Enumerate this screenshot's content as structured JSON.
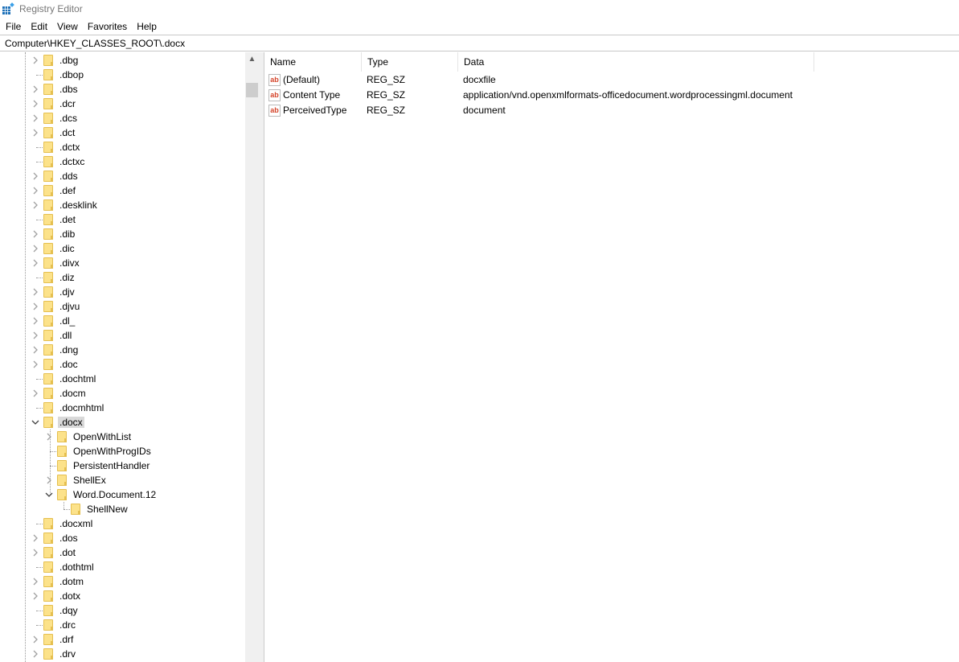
{
  "window": {
    "title": "Registry Editor"
  },
  "menu": [
    "File",
    "Edit",
    "View",
    "Favorites",
    "Help"
  ],
  "address": "Computer\\HKEY_CLASSES_ROOT\\.docx",
  "tree": [
    {
      "label": ".dbg",
      "level": 1,
      "state": "collapsed"
    },
    {
      "label": ".dbop",
      "level": 1,
      "state": "leaf"
    },
    {
      "label": ".dbs",
      "level": 1,
      "state": "collapsed"
    },
    {
      "label": ".dcr",
      "level": 1,
      "state": "collapsed"
    },
    {
      "label": ".dcs",
      "level": 1,
      "state": "collapsed"
    },
    {
      "label": ".dct",
      "level": 1,
      "state": "collapsed"
    },
    {
      "label": ".dctx",
      "level": 1,
      "state": "leaf"
    },
    {
      "label": ".dctxc",
      "level": 1,
      "state": "leaf"
    },
    {
      "label": ".dds",
      "level": 1,
      "state": "collapsed"
    },
    {
      "label": ".def",
      "level": 1,
      "state": "collapsed"
    },
    {
      "label": ".desklink",
      "level": 1,
      "state": "collapsed"
    },
    {
      "label": ".det",
      "level": 1,
      "state": "leaf"
    },
    {
      "label": ".dib",
      "level": 1,
      "state": "collapsed"
    },
    {
      "label": ".dic",
      "level": 1,
      "state": "collapsed"
    },
    {
      "label": ".divx",
      "level": 1,
      "state": "collapsed"
    },
    {
      "label": ".diz",
      "level": 1,
      "state": "leaf"
    },
    {
      "label": ".djv",
      "level": 1,
      "state": "collapsed"
    },
    {
      "label": ".djvu",
      "level": 1,
      "state": "collapsed"
    },
    {
      "label": ".dl_",
      "level": 1,
      "state": "collapsed"
    },
    {
      "label": ".dll",
      "level": 1,
      "state": "collapsed"
    },
    {
      "label": ".dng",
      "level": 1,
      "state": "collapsed"
    },
    {
      "label": ".doc",
      "level": 1,
      "state": "collapsed"
    },
    {
      "label": ".dochtml",
      "level": 1,
      "state": "leaf"
    },
    {
      "label": ".docm",
      "level": 1,
      "state": "collapsed"
    },
    {
      "label": ".docmhtml",
      "level": 1,
      "state": "leaf"
    },
    {
      "label": ".docx",
      "level": 1,
      "state": "expanded",
      "selected": true
    },
    {
      "label": "OpenWithList",
      "level": 2,
      "state": "collapsed"
    },
    {
      "label": "OpenWithProgIDs",
      "level": 2,
      "state": "leaf"
    },
    {
      "label": "PersistentHandler",
      "level": 2,
      "state": "leaf"
    },
    {
      "label": "ShellEx",
      "level": 2,
      "state": "collapsed"
    },
    {
      "label": "Word.Document.12",
      "level": 2,
      "state": "expanded"
    },
    {
      "label": "ShellNew",
      "level": 3,
      "state": "leaf"
    },
    {
      "label": ".docxml",
      "level": 1,
      "state": "leaf"
    },
    {
      "label": ".dos",
      "level": 1,
      "state": "collapsed"
    },
    {
      "label": ".dot",
      "level": 1,
      "state": "collapsed"
    },
    {
      "label": ".dothtml",
      "level": 1,
      "state": "leaf"
    },
    {
      "label": ".dotm",
      "level": 1,
      "state": "collapsed"
    },
    {
      "label": ".dotx",
      "level": 1,
      "state": "collapsed"
    },
    {
      "label": ".dqy",
      "level": 1,
      "state": "leaf"
    },
    {
      "label": ".drc",
      "level": 1,
      "state": "leaf"
    },
    {
      "label": ".drf",
      "level": 1,
      "state": "collapsed"
    },
    {
      "label": ".drv",
      "level": 1,
      "state": "collapsed"
    }
  ],
  "columns": {
    "name": "Name",
    "type": "Type",
    "data": "Data"
  },
  "values": [
    {
      "icon": "ab",
      "name": "(Default)",
      "type": "REG_SZ",
      "data": "docxfile"
    },
    {
      "icon": "ab",
      "name": "Content Type",
      "type": "REG_SZ",
      "data": "application/vnd.openxmlformats-officedocument.wordprocessingml.document"
    },
    {
      "icon": "ab",
      "name": "PerceivedType",
      "type": "REG_SZ",
      "data": "document"
    }
  ]
}
